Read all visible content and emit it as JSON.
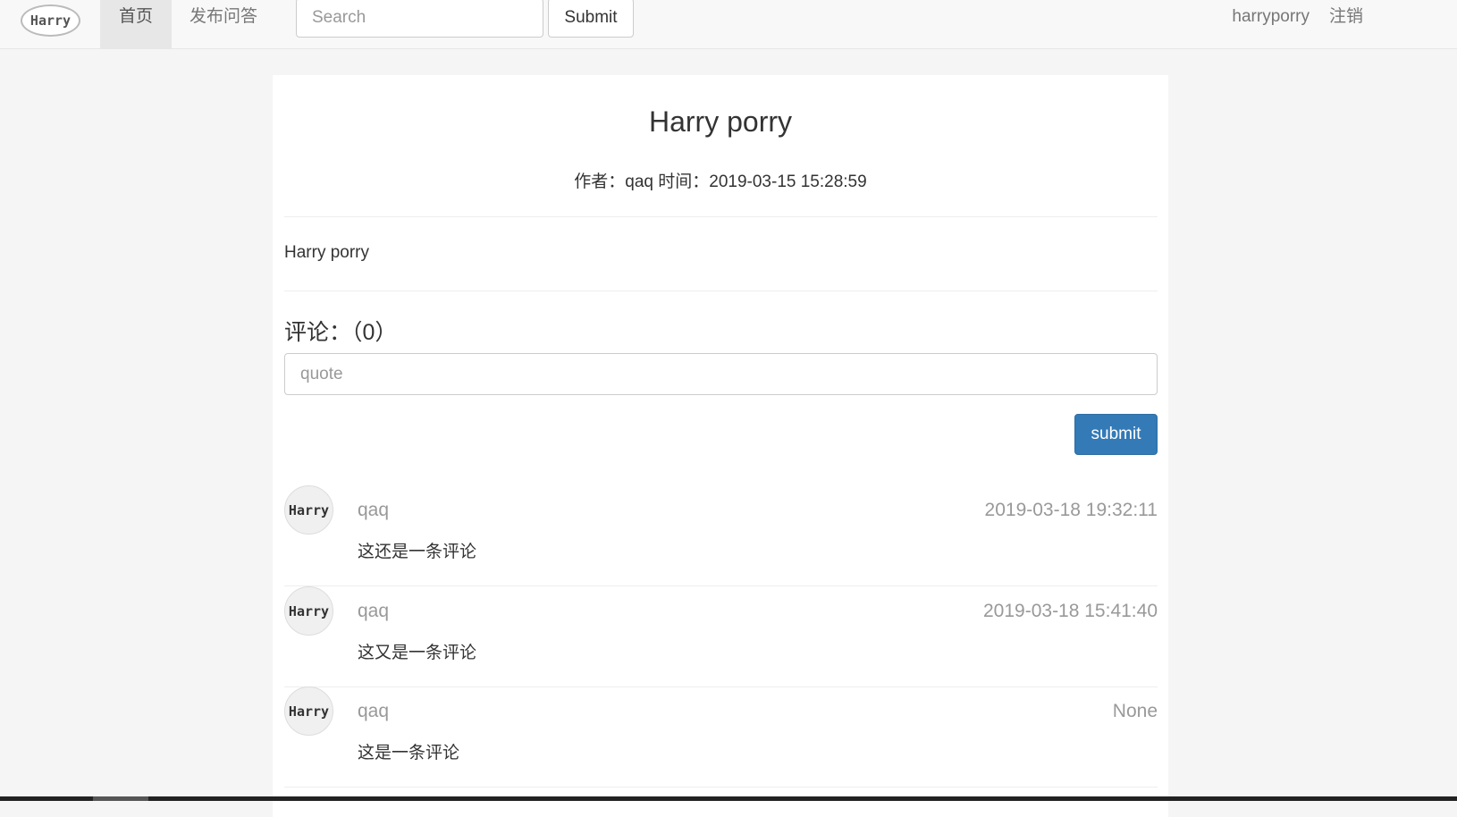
{
  "navbar": {
    "brand": "Harry",
    "home": "首页",
    "post": "发布问答",
    "search_placeholder": "Search",
    "search_button": "Submit",
    "username": "harryporry",
    "logout": "注销"
  },
  "question": {
    "title": "Harry porry",
    "meta": "作者：qaq 时间：2019-03-15 15:28:59",
    "content": "Harry porry"
  },
  "comments_section": {
    "heading": "评论：（0）",
    "input_placeholder": "quote",
    "submit": "submit"
  },
  "comments": [
    {
      "avatar": "Harry",
      "user": "qaq",
      "time": "2019-03-18 19:32:11",
      "text": "这还是一条评论"
    },
    {
      "avatar": "Harry",
      "user": "qaq",
      "time": "2019-03-18 15:41:40",
      "text": "这又是一条评论"
    },
    {
      "avatar": "Harry",
      "user": "qaq",
      "time": "None",
      "text": "这是一条评论"
    }
  ]
}
